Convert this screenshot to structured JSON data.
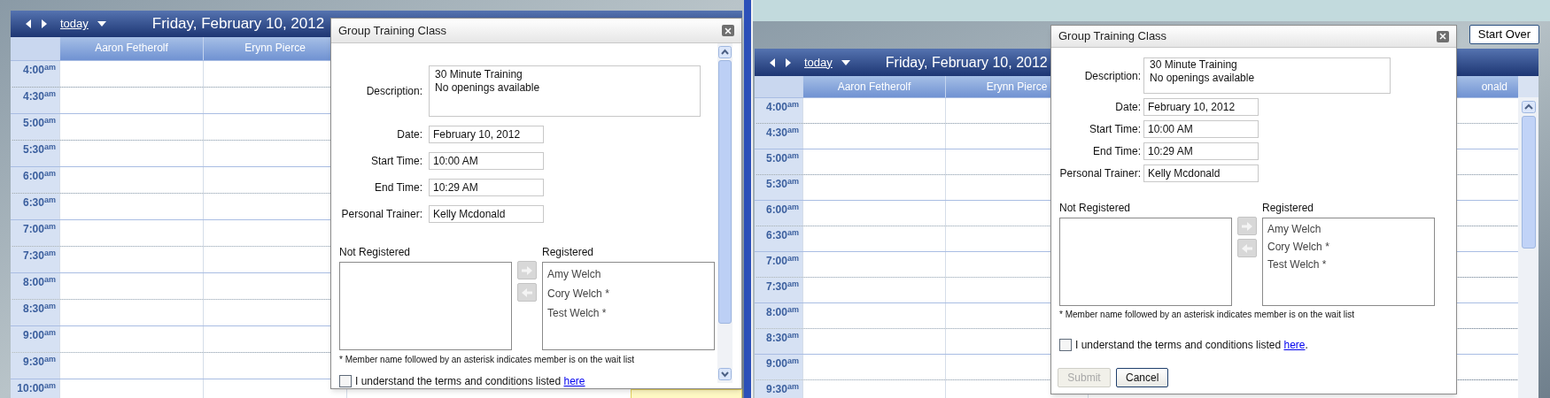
{
  "screens": [
    {
      "calendar": {
        "today_link": "today",
        "date_title": "Friday, February 10, 2012",
        "columns": [
          {
            "label": "Aaron Fetherolf"
          },
          {
            "label": "Erynn Pierce"
          }
        ],
        "times": [
          "4:00$^{am}$",
          "4:30$^{am}$",
          "5:00$^{am}$",
          "5:30$^{am}$",
          "6:00$^{am}$",
          "6:30$^{am}$",
          "7:00$^{am}$",
          "7:30$^{am}$",
          "8:00$^{am}$",
          "8:30$^{am}$",
          "9:00$^{am}$",
          "9:30$^{am}$",
          "10:00$^{am}$"
        ]
      },
      "dialog": {
        "title": "Group Training Class",
        "fields": [
          {
            "kind": "multiline",
            "label": "Description:",
            "lines": [
              "30 Minute Training",
              "No openings available"
            ]
          },
          {
            "kind": "text",
            "label": "Date:",
            "value": "February 10, 2012"
          },
          {
            "kind": "text",
            "label": "Start Time:",
            "value": "10:00 AM"
          },
          {
            "kind": "text",
            "label": "End Time:",
            "value": "10:29 AM"
          },
          {
            "kind": "text",
            "label": "Personal Trainer:",
            "value": "Kelly Mcdonald"
          }
        ],
        "not_registered": {
          "heading": "Not Registered"
        },
        "transfer_buttons": [
          {
            "kind": "right",
            "disabled": true
          },
          {
            "kind": "left",
            "disabled": true
          }
        ],
        "registered": {
          "heading": "Registered",
          "members": [
            "Amy Welch",
            "Cory Welch *",
            "Test Welch *"
          ]
        },
        "footnote": "* Member name followed by an asterisk indicates member is on the wait list",
        "terms": {
          "checked": false,
          "text": "I understand the terms and conditions listed",
          "link": "here"
        }
      }
    },
    {
      "start_over": "Start Over",
      "calendar": {
        "today_link": "today",
        "date_title": "Friday, February 10, 2012",
        "columns": [
          {
            "label": "Aaron Fetherolf"
          },
          {
            "label": "Erynn Pierce"
          },
          {
            "label": "onald"
          }
        ],
        "times": [
          "4:00$^{am}$",
          "4:30$^{am}$",
          "5:00$^{am}$",
          "5:30$^{am}$",
          "6:00$^{am}$",
          "6:30$^{am}$",
          "7:00$^{am}$",
          "7:30$^{am}$",
          "8:00$^{am}$",
          "8:30$^{am}$",
          "9:00$^{am}$",
          "9:30$^{am}$"
        ]
      },
      "dialog": {
        "title": "Group Training Class",
        "fields": [
          {
            "kind": "multiline",
            "label": "Description:",
            "lines": [
              "30 Minute Training",
              "No openings available"
            ]
          },
          {
            "kind": "text",
            "label": "Date:",
            "value": "February 10, 2012"
          },
          {
            "kind": "text",
            "label": "Start Time:",
            "value": "10:00 AM"
          },
          {
            "kind": "text",
            "label": "End Time:",
            "value": "10:29 AM"
          },
          {
            "kind": "text",
            "label": "Personal Trainer:",
            "value": "Kelly Mcdonald"
          }
        ],
        "not_registered": {
          "heading": "Not Registered"
        },
        "transfer_buttons": [
          {
            "kind": "right",
            "disabled": true
          },
          {
            "kind": "left",
            "disabled": true
          }
        ],
        "registered": {
          "heading": "Registered",
          "members": [
            "Amy Welch",
            "Cory Welch *",
            "Test Welch *"
          ]
        },
        "footnote": "* Member name followed by an asterisk indicates member is on the wait list",
        "terms": {
          "checked": false,
          "text": "I understand the terms and conditions listed",
          "link": "here",
          "after": "."
        },
        "buttons": [
          {
            "label": "Submit",
            "disabled": true
          },
          {
            "label": "Cancel",
            "disabled": false
          }
        ]
      }
    }
  ]
}
